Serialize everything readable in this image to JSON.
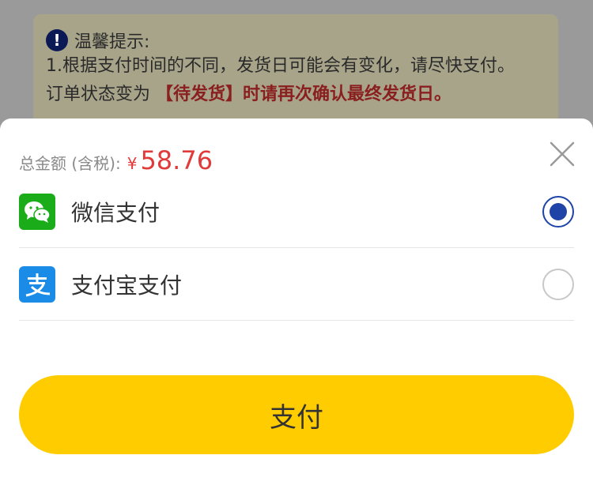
{
  "notice": {
    "title": "温馨提示:",
    "line1": "1.根据支付时间的不同，发货日可能会有变化，请尽快支付。",
    "line2_prefix": "订单状态变为",
    "line2_emphasis": "【待发货】时请再次确认最终发货日。"
  },
  "sheet": {
    "total_label": "总金额 (含税):",
    "currency": "¥",
    "amount": "58.76",
    "close_icon": "close-icon",
    "methods": [
      {
        "label": "微信支付",
        "icon": "wechat-icon",
        "selected": true
      },
      {
        "label": "支付宝支付",
        "icon": "alipay-icon",
        "selected": false
      }
    ],
    "pay_button": "支付"
  },
  "colors": {
    "accent_yellow": "#ffcc00",
    "price_red": "#e03a3a",
    "radio_blue": "#1e44a8",
    "wechat_green": "#1aad19",
    "alipay_blue": "#1a8be6"
  }
}
